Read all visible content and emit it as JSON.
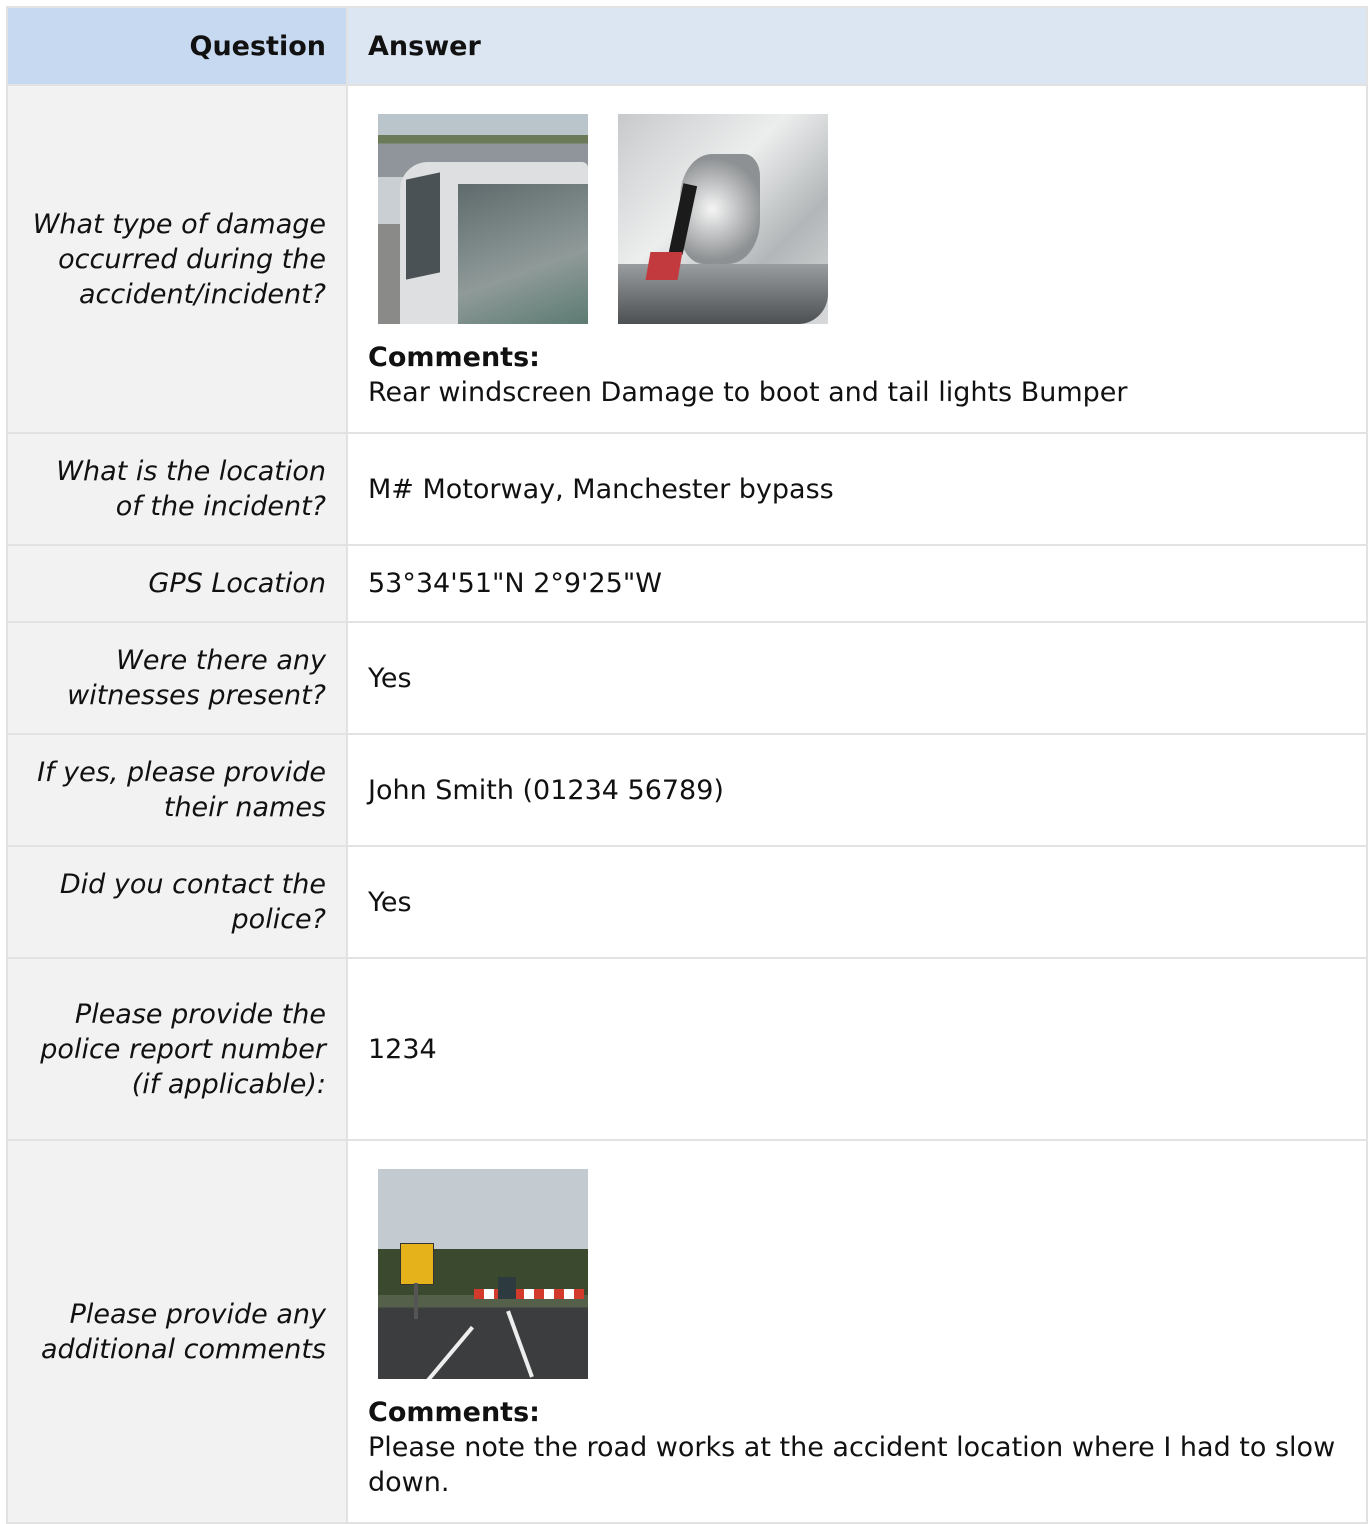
{
  "headers": {
    "question": "Question",
    "answer": "Answer"
  },
  "rows": {
    "damage": {
      "question": "What type of damage occurred during the accident/incident?",
      "comments_label": "Comments:",
      "comments": "Rear windscreen Damage to boot and tail lights Bumper"
    },
    "location": {
      "question": "What is the location of the incident?",
      "answer": "M# Motorway, Manchester bypass"
    },
    "gps": {
      "question": "GPS Location",
      "answer": "53°34'51\"N 2°9'25\"W"
    },
    "witnesses": {
      "question": "Were there any witnesses present?",
      "answer": "Yes"
    },
    "witness_names": {
      "question": "If yes, please provide their names",
      "answer": "John Smith (01234 56789)"
    },
    "police": {
      "question": "Did you contact the police?",
      "answer": "Yes"
    },
    "police_report": {
      "question": "Please provide the police report number (if applicable):",
      "answer": "1234"
    },
    "additional": {
      "question": "Please provide any additional comments",
      "comments_label": "Comments:",
      "comments": "Please note the road works at the accident location where I had to slow down."
    }
  }
}
